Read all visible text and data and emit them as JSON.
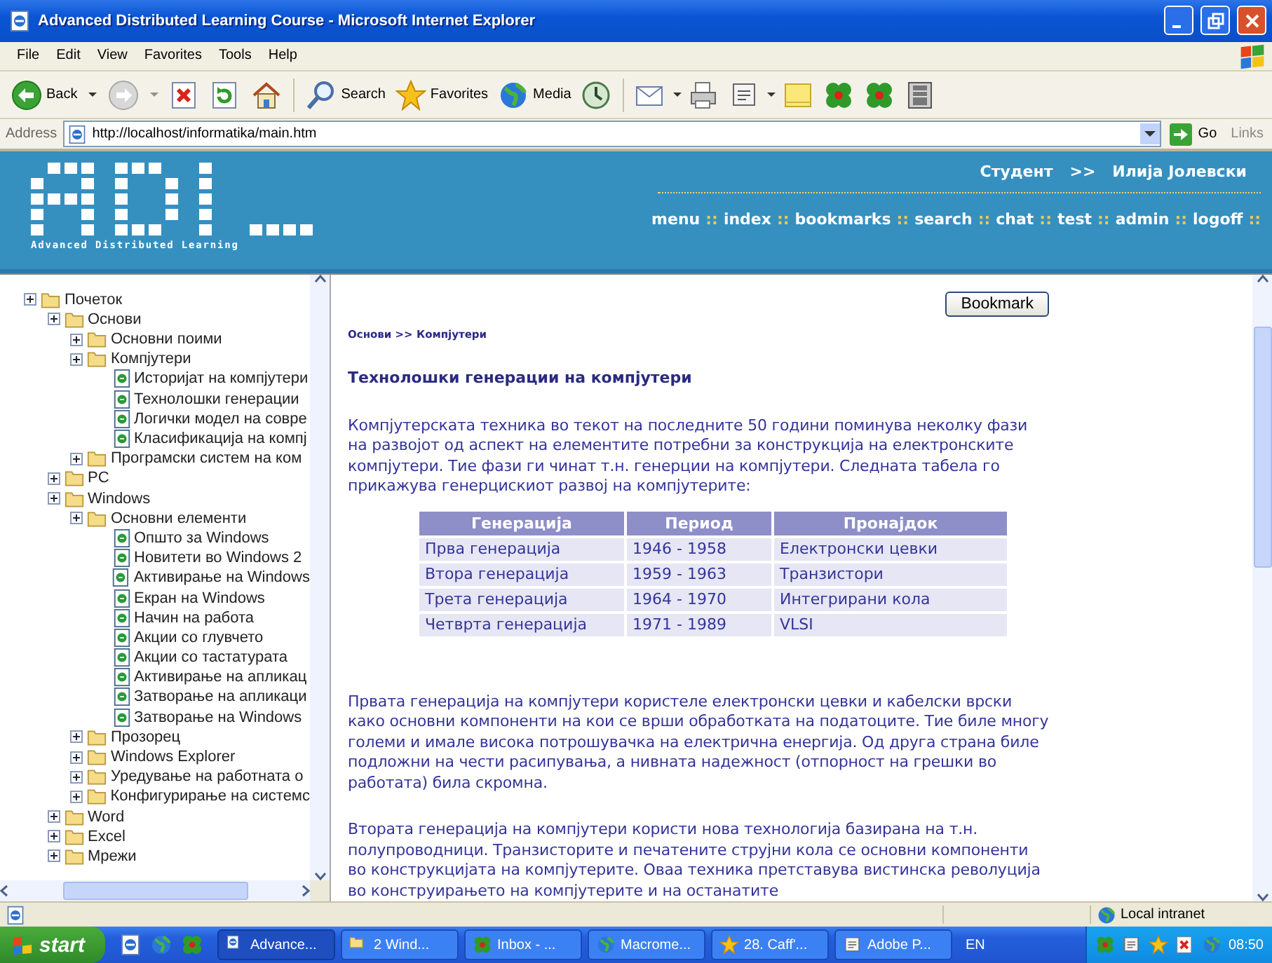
{
  "window": {
    "title": "Advanced Distributed Learning Course - Microsoft Internet Explorer"
  },
  "menu": [
    "File",
    "Edit",
    "View",
    "Favorites",
    "Tools",
    "Help"
  ],
  "toolbar": {
    "back": "Back",
    "search": "Search",
    "favorites": "Favorites",
    "media": "Media"
  },
  "address": {
    "label": "Address",
    "url": "http://localhost/informatika/main.htm",
    "go": "Go",
    "links": "Links"
  },
  "header": {
    "tagline": "Advanced Distributed Learning",
    "role": "Студент",
    "arrow": ">>",
    "user": "Илија Јолевски",
    "nav": [
      {
        "label": "menu",
        "separator": "::"
      },
      {
        "label": "index",
        "separator": "::"
      },
      {
        "label": "bookmarks",
        "separator": "::"
      },
      {
        "label": "search",
        "separator": "::"
      },
      {
        "label": "chat",
        "separator": "::"
      },
      {
        "label": "test",
        "separator": "::"
      },
      {
        "label": "admin",
        "separator": "::"
      },
      {
        "label": "logoff",
        "separator": "::"
      }
    ]
  },
  "tree": [
    {
      "label": "Почеток",
      "kind": "folder",
      "children": [
        {
          "label": "Основи",
          "kind": "folder",
          "children": [
            {
              "label": "Основни поими",
              "kind": "folder"
            },
            {
              "label": "Компјутери",
              "kind": "folder",
              "children": [
                {
                  "label": "Историјат на компјутери",
                  "kind": "page"
                },
                {
                  "label": "Технолошки генерации",
                  "kind": "page"
                },
                {
                  "label": "Логички модел на совре",
                  "kind": "page"
                },
                {
                  "label": "Класификација на компј",
                  "kind": "page"
                }
              ]
            },
            {
              "label": "Програмски систем на ком",
              "kind": "folder"
            }
          ]
        },
        {
          "label": "PC",
          "kind": "folder"
        },
        {
          "label": "Windows",
          "kind": "folder",
          "children": [
            {
              "label": "Основни елементи",
              "kind": "folder",
              "children": [
                {
                  "label": "Општо за Windows",
                  "kind": "page"
                },
                {
                  "label": "Новитети во Windows 2",
                  "kind": "page"
                },
                {
                  "label": "Активирање на Windows",
                  "kind": "page"
                },
                {
                  "label": "Екран на Windows",
                  "kind": "page"
                },
                {
                  "label": "Начин на работа",
                  "kind": "page"
                },
                {
                  "label": "Акции со глувчето",
                  "kind": "page"
                },
                {
                  "label": "Акции со тастатурата",
                  "kind": "page"
                },
                {
                  "label": "Активирање на апликац",
                  "kind": "page"
                },
                {
                  "label": "Затворање на апликаци",
                  "kind": "page"
                },
                {
                  "label": "Затворање на Windows",
                  "kind": "page"
                }
              ]
            },
            {
              "label": "Прозорец",
              "kind": "folder"
            },
            {
              "label": "Windows Explorer",
              "kind": "folder"
            },
            {
              "label": "Уредување на работната о",
              "kind": "folder"
            },
            {
              "label": "Конфигурирање на системс",
              "kind": "folder"
            }
          ]
        },
        {
          "label": "Word",
          "kind": "folder"
        },
        {
          "label": "Excel",
          "kind": "folder"
        },
        {
          "label": "Мрежи",
          "kind": "folder"
        }
      ]
    }
  ],
  "content": {
    "button": "Bookmark",
    "breadcrumb": "Основи >> Компјутери",
    "heading": "Технолошки генерации на компјутери",
    "intro": "Компјутерската техника во текот на последните 50 години поминува неколку фази на развојот од аспект на елементите потребни за конструкција на електронските компјутери. Тие фази ги чинат т.н. генерции на компјутери. Следната табела го прикажува генерцискиот развој на компјутерите:",
    "table": {
      "columns": [
        "Генерација",
        "Период",
        "Пронајдок"
      ],
      "rows": [
        [
          "Прва генерација",
          "1946 - 1958",
          "Електронски цевки"
        ],
        [
          "Втора генерација",
          "1959 - 1963",
          "Транзистори"
        ],
        [
          "Трета генерација",
          "1964 - 1970",
          "Интегрирани кола"
        ],
        [
          "Четврта генерација",
          "1971 - 1989",
          "VLSI"
        ]
      ]
    },
    "paragraphs": [
      "Првата генерација на компјутери користеле електронски цевки и кабелски врски како основни компоненти на кои се врши обработката на податоците. Тие биле многу големи и имале висока потрошувачка на електрична енергија. Од друга страна биле подложни на чести расипувања, а нивната надежност (отпорност на грешки во работата) била скромна.",
      "Втората генерација на компјутери користи нова технологија базирана на т.н. полупроводници. Транзисторите и печатените струјни кола се основни компоненти во конструкцијата на компјутерите. Оваа техника претставува вистинска револуција во конструирањето на компјутерите и на останатите"
    ]
  },
  "status_bar": {
    "zone": "Local intranet"
  },
  "taskbar": {
    "start": "start",
    "tasks": [
      {
        "label": "Advance...",
        "selected": true
      },
      {
        "label": "2 Wind...",
        "selected": false
      },
      {
        "label": "Inbox - ...",
        "selected": false
      },
      {
        "label": "Macrome...",
        "selected": false
      },
      {
        "label": "28. Caff'...",
        "selected": false
      },
      {
        "label": "Adobe P...",
        "selected": false
      }
    ],
    "language": "EN",
    "clock": "08:50"
  }
}
